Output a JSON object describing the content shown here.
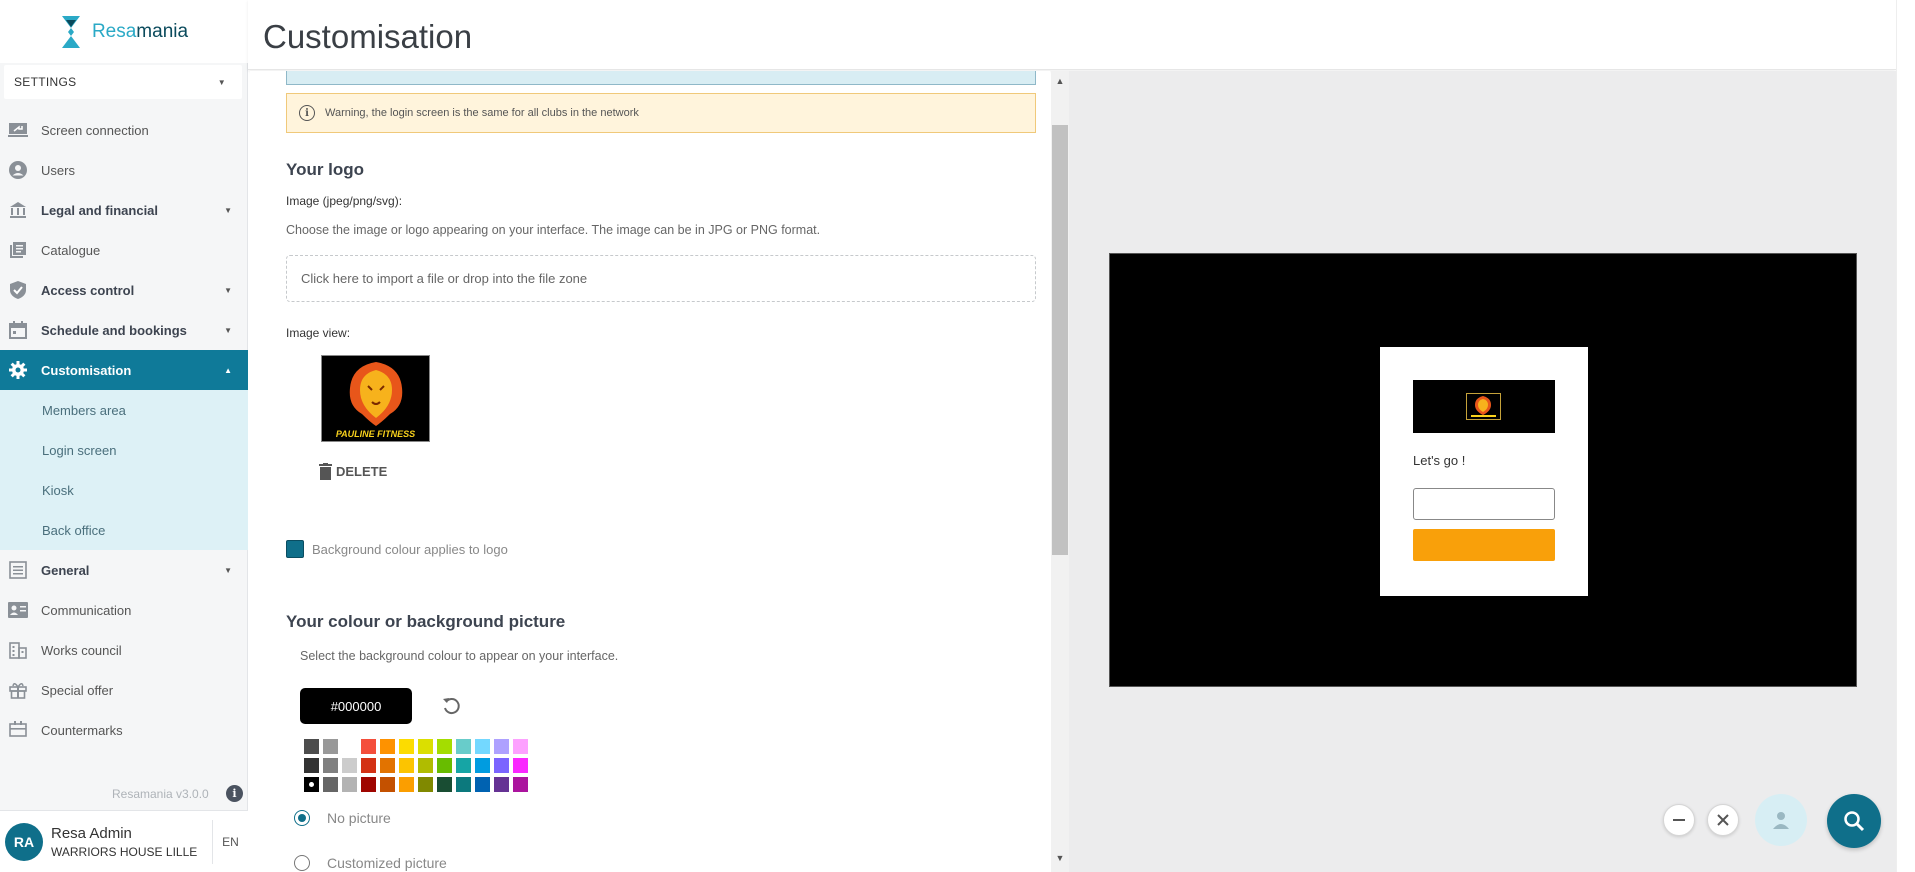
{
  "brand": {
    "name_part1": "Resa",
    "name_part2": "mania"
  },
  "settings_select": {
    "label": "SETTINGS"
  },
  "sidebar": {
    "items": [
      {
        "label": "Screen connection"
      },
      {
        "label": "Users"
      },
      {
        "label": "Legal and financial"
      },
      {
        "label": "Catalogue"
      },
      {
        "label": "Access control"
      },
      {
        "label": "Schedule and bookings"
      },
      {
        "label": "Customisation"
      },
      {
        "label": "General"
      },
      {
        "label": "Communication"
      },
      {
        "label": "Works council"
      },
      {
        "label": "Special offer"
      },
      {
        "label": "Countermarks"
      }
    ],
    "sub_items": [
      {
        "label": "Members area"
      },
      {
        "label": "Login screen"
      },
      {
        "label": "Kiosk"
      },
      {
        "label": "Back office"
      }
    ],
    "version": "Resamania v3.0.0"
  },
  "user": {
    "initials": "RA",
    "name": "Resa Admin",
    "club": "WARRIORS HOUSE LILLE",
    "lang": "EN"
  },
  "header": {
    "title": "Customisation"
  },
  "form": {
    "warning": "Warning, the login screen is the same for all clubs in the network",
    "logo_section_title": "Your logo",
    "image_label": "Image (jpeg/png/svg):",
    "image_help": "Choose the image or logo appearing on your interface. The image can be in JPG or PNG format.",
    "dropzone_text": "Click here to import a file or drop into the file zone",
    "image_view_label": "Image view:",
    "logo_text": "PAULINE FITNESS",
    "delete_label": "DELETE",
    "bg_applies_label": "Background colour applies to logo",
    "colour_section_title": "Your colour or background picture",
    "colour_help": "Select the background colour to appear on your interface.",
    "colour_value": "#000000",
    "palette": [
      "#4d4d4d",
      "#999999",
      "#ffffff",
      "#f44e3b",
      "#fe9200",
      "#fcdc00",
      "#dbdf00",
      "#a4dd00",
      "#68ccca",
      "#73d8ff",
      "#aea1ff",
      "#fda1ff",
      "#333333",
      "#808080",
      "#cccccc",
      "#d33115",
      "#e27300",
      "#fcc400",
      "#b0bc00",
      "#68bc00",
      "#16a5a5",
      "#009ce0",
      "#7b64ff",
      "#fa28ff",
      "#000000",
      "#666666",
      "#b3b3b3",
      "#9f0500",
      "#c45100",
      "#fb9e00",
      "#808900",
      "#194d33",
      "#0c797d",
      "#0062b1",
      "#653294",
      "#ab149e"
    ],
    "radio_no_picture": "No picture",
    "radio_custom_picture": "Customized picture"
  },
  "preview": {
    "greeting": "Let's go !"
  }
}
